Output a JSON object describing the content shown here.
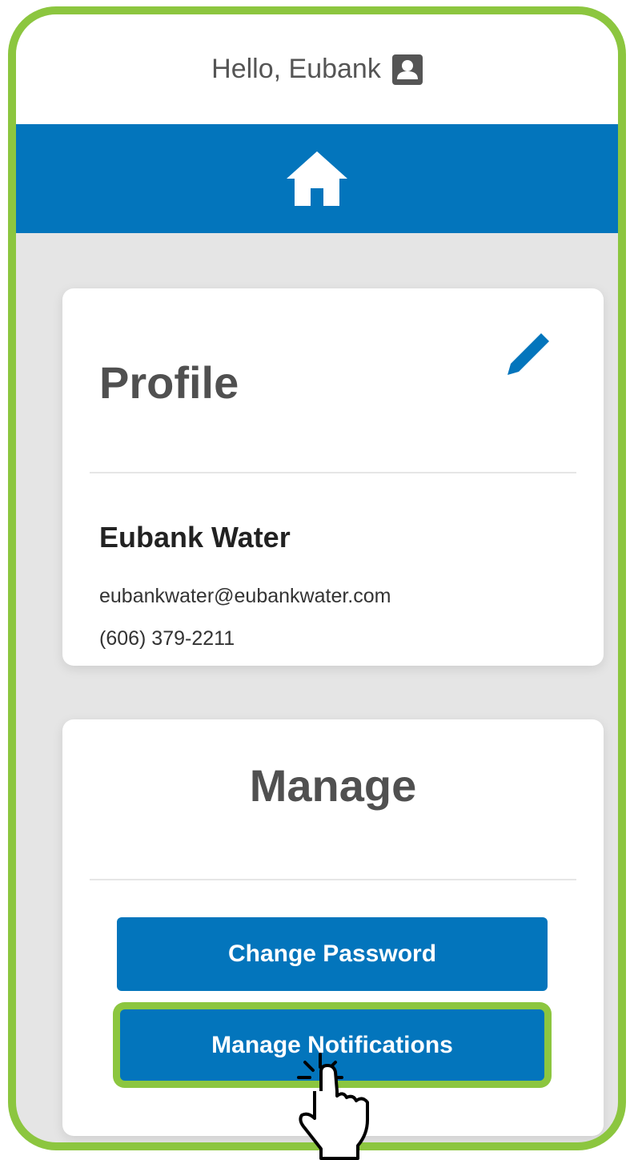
{
  "header": {
    "greeting": "Hello, Eubank"
  },
  "icons": {
    "user": "user-account-icon",
    "home": "home-icon",
    "edit": "pencil-edit-icon",
    "cursor": "hand-pointer-cursor"
  },
  "colors": {
    "brand_blue": "#0375bc",
    "highlight_green": "#8cc63f",
    "page_bg": "#e5e5e5"
  },
  "profile": {
    "title": "Profile",
    "name": "Eubank Water",
    "email": "eubankwater@eubankwater.com",
    "phone": "(606) 379-2211"
  },
  "manage": {
    "title": "Manage",
    "buttons": [
      {
        "label": "Change Password"
      },
      {
        "label": "Manage Notifications"
      }
    ]
  }
}
